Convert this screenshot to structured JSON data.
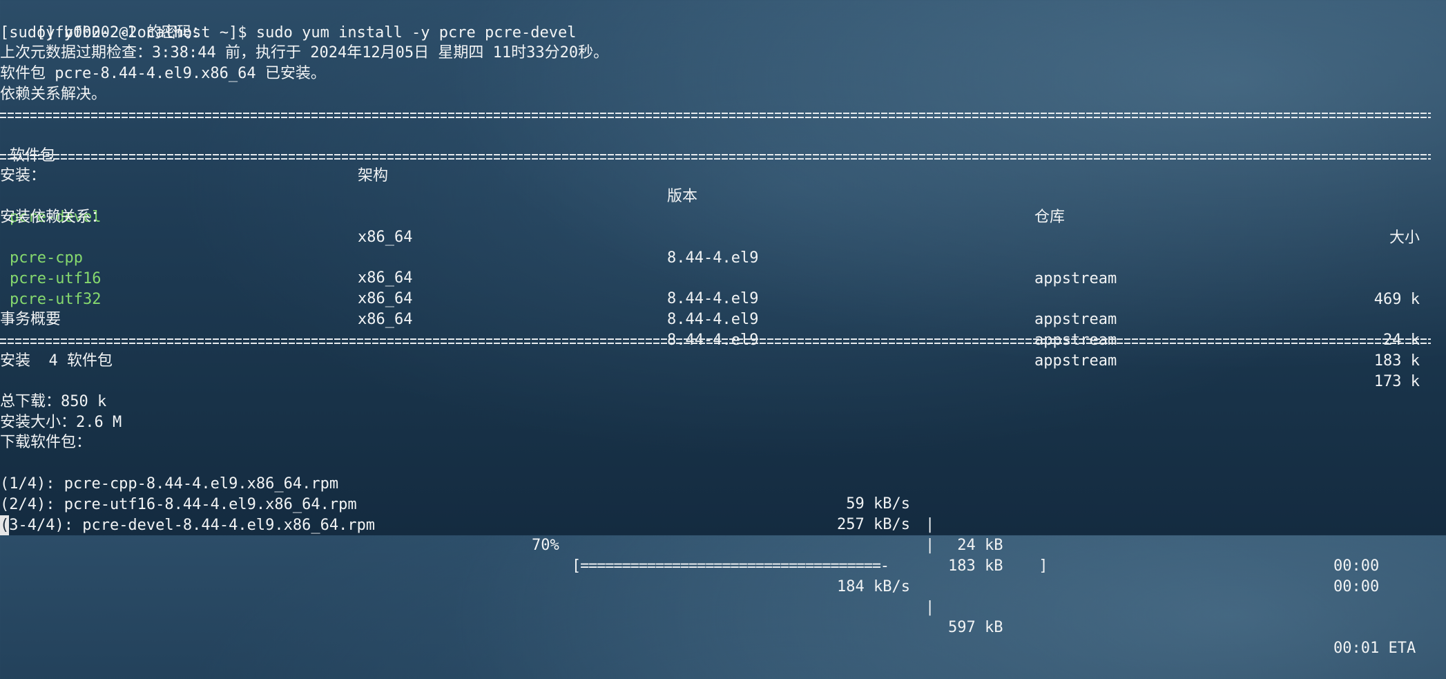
{
  "prompt": "[yfb002-2@localhost ~]$ ",
  "command": "sudo yum install -y pcre pcre-devel",
  "lines": {
    "sudo": "[sudo] yfb002-2 的密码：",
    "metadata": "上次元数据过期检查：3:38:44 前，执行于 2024年12月05日 星期四 11时33分20秒。",
    "installed": "软件包 pcre-8.44-4.el9.x86_64 已安装。",
    "resolved": "依赖关系解决。"
  },
  "table": {
    "headers": {
      "package": "软件包",
      "arch": "架构",
      "version": "版本",
      "repo": "仓库",
      "size": "大小"
    },
    "install_label": "安装：",
    "deps_label": "安装依赖关系：",
    "rows": [
      {
        "name": "pcre-devel",
        "arch": "x86_64",
        "version": "8.44-4.el9",
        "repo": "appstream",
        "size": "469 k"
      },
      {
        "name": "pcre-cpp",
        "arch": "x86_64",
        "version": "8.44-4.el9",
        "repo": "appstream",
        "size": "24 k"
      },
      {
        "name": "pcre-utf16",
        "arch": "x86_64",
        "version": "8.44-4.el9",
        "repo": "appstream",
        "size": "183 k"
      },
      {
        "name": "pcre-utf32",
        "arch": "x86_64",
        "version": "8.44-4.el9",
        "repo": "appstream",
        "size": "173 k"
      }
    ]
  },
  "summary": {
    "title": "事务概要",
    "install": "安装  4 软件包",
    "total_download": "总下载：850 k",
    "install_size": "安装大小：2.6 M",
    "downloading": "下载软件包："
  },
  "downloads": [
    {
      "label": "(1/4): pcre-cpp-8.44-4.el9.x86_64.rpm",
      "rate": "59 kB/s",
      "size": " 24 kB",
      "time": "00:00"
    },
    {
      "label": "(2/4): pcre-utf16-8.44-4.el9.x86_64.rpm",
      "rate": "257 kB/s",
      "size": "183 kB",
      "time": "00:00"
    }
  ],
  "progress": {
    "cursor_char": "(",
    "label": "3-4/4): pcre-devel-8.44-4.el9.x86_64.rpm",
    "percent": "70%",
    "bar": "[====================================-                  ]",
    "rate": "184 kB/s",
    "size": "597 kB",
    "time": "00:01 ETA"
  },
  "separator_char": "="
}
